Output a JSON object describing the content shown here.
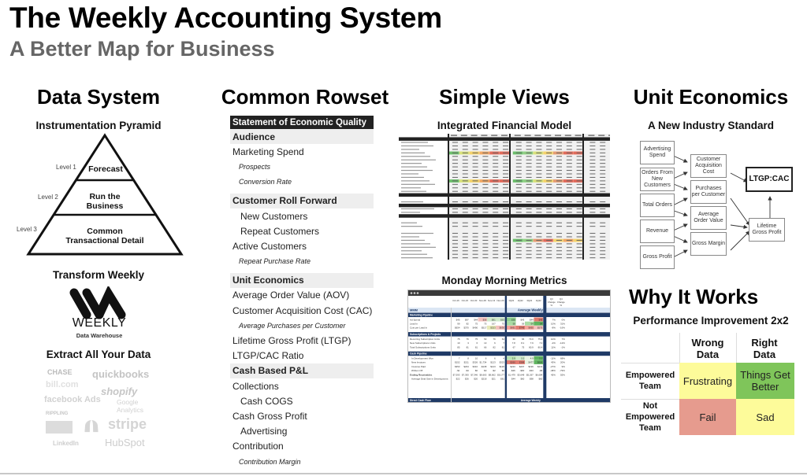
{
  "header": {
    "title": "The Weekly Accounting System",
    "subtitle": "A Better Map for Business"
  },
  "data_system": {
    "heading": "Data System",
    "pyramid_title": "Instrumentation Pyramid",
    "levels": [
      {
        "label": "Level 1",
        "text_line1": "Forecast",
        "text_line2": ""
      },
      {
        "label": "Level 2",
        "text_line1": "Run the",
        "text_line2": "Business"
      },
      {
        "label": "Level 3",
        "text_line1": "Common",
        "text_line2": "Transactional Detail"
      }
    ],
    "transform_title": "Transform Weekly",
    "logo_word": "WEEKLY",
    "logo_sub": "Data Warehouse",
    "extract_title": "Extract All Your Data",
    "brands": [
      "CHASE",
      "quickbooks",
      "bill.com",
      "shopify",
      "facebook Ads",
      "Google Analytics",
      "RIPPLING",
      "stripe",
      "LinkedIn",
      "HubSpot"
    ]
  },
  "rowset": {
    "heading": "Common Rowset",
    "title": "Statement of Economic Quality",
    "rows": [
      {
        "type": "section",
        "label": "Audience"
      },
      {
        "type": "item",
        "label": "Marketing Spend"
      },
      {
        "type": "italic",
        "label": "Prospects"
      },
      {
        "type": "italic",
        "label": "Conversion Rate"
      },
      {
        "type": "gap",
        "label": ""
      },
      {
        "type": "section",
        "label": "Customer Roll Forward"
      },
      {
        "type": "sub",
        "label": "New Customers"
      },
      {
        "type": "sub",
        "label": "Repeat Customers"
      },
      {
        "type": "item",
        "label": "Active Customers"
      },
      {
        "type": "italic",
        "label": "Repeat Purchase Rate"
      },
      {
        "type": "gap",
        "label": ""
      },
      {
        "type": "section",
        "label": "Unit Economics"
      },
      {
        "type": "item",
        "label": "Average Order Value (AOV)"
      },
      {
        "type": "item",
        "label": "Customer Acquisition Cost (CAC)"
      },
      {
        "type": "italic",
        "label": "Average Purchases per Customer"
      },
      {
        "type": "item",
        "label": "Lifetime Gross Profit (LTGP)"
      },
      {
        "type": "item",
        "label": "LTGP/CAC Ratio"
      },
      {
        "type": "section",
        "label": "Cash Based P&L"
      },
      {
        "type": "item",
        "label": "Collections"
      },
      {
        "type": "sub",
        "label": "Cash COGS"
      },
      {
        "type": "item",
        "label": "Cash Gross Profit"
      },
      {
        "type": "sub",
        "label": "Advertising"
      },
      {
        "type": "item",
        "label": "Contribution"
      },
      {
        "type": "italic",
        "label": "Contribution Margin"
      }
    ]
  },
  "simple_views": {
    "heading": "Simple Views",
    "model_title": "Integrated Financial Model",
    "metrics_title": "Monday Morning Metrics",
    "metrics_sheet": {
      "columns": [
        "Oct-16",
        "Oct-23",
        "Oct-30",
        "Nov-06",
        "Nov-13",
        "Nov-20",
        "1Q22",
        "2Q22",
        "3Q22",
        "4Q22",
        "Q3 Change %",
        "Q4 Change %"
      ],
      "banner_left": "MMM",
      "banner_right": "Average Weekly",
      "sections": [
        {
          "name": "Marketing Pipeline",
          "rows": [
            {
              "label": "Ad Spend",
              "vals": [
                "$45",
                "$97",
                "$44",
                "$36",
                "$81",
                "$63",
                "$38",
                "$43",
                "$44",
                "$49",
                "7%",
                "0%"
              ]
            },
            {
              "label": "Lead In",
              "vals": [
                "99",
                "82",
                "75",
                "75",
                "167",
                "75",
                "58",
                "59",
                "64",
                "84",
                "10%",
                "31%"
              ]
            },
            {
              "label": "Cost per Lead In",
              "vals": [
                "$654",
                "$370",
                "$490",
                "$517",
                "$323",
                "$636",
                "$691",
                "$749",
                "$690",
                "$575",
                "-8%",
                "-16%"
              ]
            }
          ]
        },
        {
          "name": "Subscriptions & Projects",
          "rows": [
            {
              "label": "Recurring Subscription Units",
              "vals": [
                "75",
                "76",
                "75",
                "53",
                "76",
                "64",
                "60",
                "66",
                "73.0",
                "75.4",
                "10%",
                "7%"
              ]
            },
            {
              "label": "New Subscriptions Units",
              "vals": [
                "10",
                "3",
                "6",
                "13",
                "6",
                "7",
                "7.8",
                "8.1",
                "7.9",
                "7.0",
                "-2%",
                "-12%"
              ]
            },
            {
              "label": "Total Subscriptions Units",
              "vals": [
                "85",
                "81",
                "81",
                "66",
                "82",
                "81",
                "67",
                "75",
                "80.9",
                "80.4",
                "11%",
                "-1%"
              ]
            }
          ]
        },
        {
          "name": "Cash Pipeline",
          "rows": [
            {
              "label": "In Development Won",
              "vals": [
                "7",
                "8",
                "10",
                "6",
                "6",
                "4",
                "5.9",
                "5.5",
                "4.9",
                "5.1",
                "-11%",
                "68%"
              ]
            },
            {
              "label": "New Invoices",
              "vals": [
                "$152",
                "$211",
                "$326",
                "$1,734",
                "$123",
                "$323",
                "$260",
                "$388",
                "$477",
                "$664",
                "43%",
                "20%"
              ]
            },
            {
              "label": "Invoices Paid",
              "vals": [
                "$353",
                "$204",
                "$310",
                "-$138",
                "$123",
                "$126",
                "$223",
                "$267",
                "$199",
                "$213",
                "-27%",
                "9%"
              ]
            },
            {
              "label": "Written Off",
              "vals": [
                "-$1",
                "-$4",
                "$0",
                "$0",
                "-$2",
                "$0",
                "-$26",
                "-$60",
                "-$33",
                "-$8",
                "-48%",
                "-79%"
              ]
            },
            {
              "label": "Ending Receivables",
              "vals": [
                "$7,393",
                "$7,393",
                "$7,346",
                "$8,663",
                "$8,662",
                "$9,177",
                "$1,479",
                "$3,649",
                "$5,267",
                "$6,084",
                "45%",
                "55%"
              ]
            },
            {
              "label": "Average Deal Size in Development",
              "vals": [
                "$22",
                "$26",
                "$20",
                "$218",
                "$21",
                "$81",
                "$44",
                "$60",
                "$98",
                "$60",
                "",
                ""
              ]
            }
          ]
        }
      ],
      "footer_left": "Direct Cash Flow",
      "footer_right": "Average Weekly"
    }
  },
  "unit_economics": {
    "heading": "Unit Economics",
    "subheading": "A New Industry Standard",
    "inputs": [
      "Advertising Spend",
      "Orders From New Customers",
      "Total Orders",
      "Revenue",
      "Gross Profit"
    ],
    "middle": [
      "Customer Acquisition Cost",
      "Purchases per Customer",
      "Average Order Value",
      "Gross Margin"
    ],
    "ltgp": "Lifetime Gross Profit",
    "result": "LTGP:CAC"
  },
  "why_it_works": {
    "heading": "Why It Works",
    "subheading": "Performance Improvement 2x2",
    "col_headers": [
      [
        "Wrong",
        "Data"
      ],
      [
        "Right",
        "Data"
      ]
    ],
    "row_headers": [
      [
        "Empowered",
        "Team"
      ],
      [
        "Not",
        "Empowered",
        "Team"
      ]
    ],
    "cells": [
      [
        "Frustrating",
        "Things Get Better"
      ],
      [
        "Fail",
        "Sad"
      ]
    ],
    "colors": {
      "yellow": "#fdfb9a",
      "green": "#7fc55a",
      "red": "#e69b8e"
    }
  }
}
